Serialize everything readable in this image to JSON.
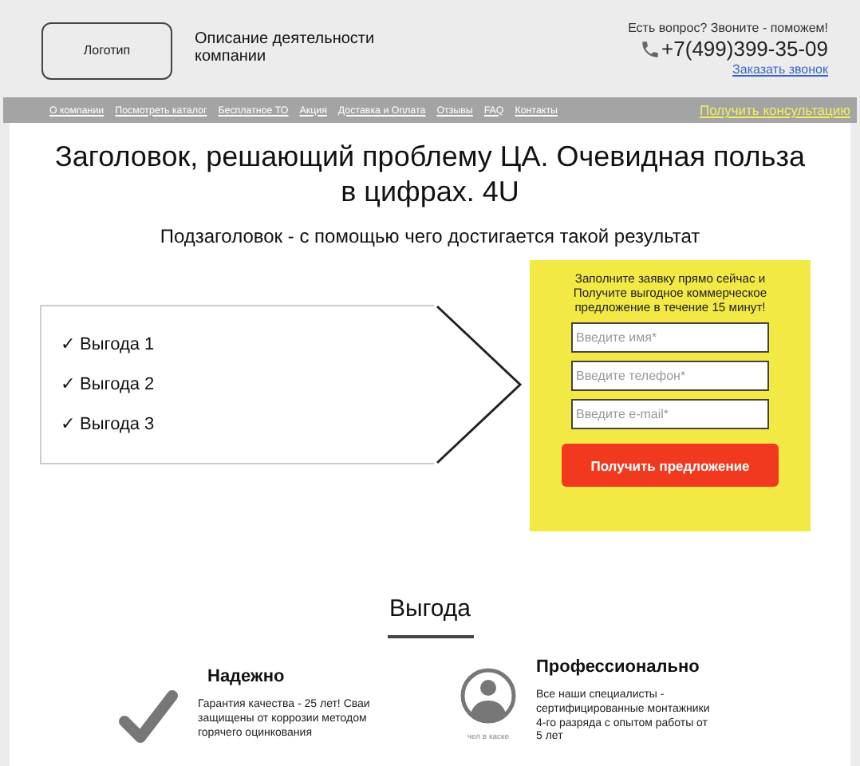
{
  "header": {
    "logo": "Логотип",
    "description": "Описание деятельности компании",
    "question": "Есть вопрос? Звоните - поможем!",
    "phone": "+7(499)399-35-09",
    "callback": "Заказать звонок"
  },
  "nav": {
    "items": [
      "О компании",
      "Посмотреть каталог",
      "Бесплатное ТО",
      "Акция",
      "Доставка и Оплата",
      "Отзывы",
      "FAQ",
      "Контакты"
    ],
    "cta": "Получить консультацию"
  },
  "hero": {
    "title": "Заголовок, решающий проблему ЦА. Очевидная польза в цифрах. 4U",
    "subtitle": "Подзаголовок - с помощью чего достигается такой результат",
    "benefits": [
      {
        "mark": "✓",
        "text": "Выгода 1"
      },
      {
        "mark": "✓",
        "text": "Выгода 2"
      },
      {
        "mark": "✓",
        "text": "Выгода 3"
      }
    ],
    "form": {
      "text": "Заполните заявку прямо сейчас и Получите выгодное коммерческое предложение в течение 15 минут!",
      "fields": [
        {
          "placeholder": "Введите имя*"
        },
        {
          "placeholder": "Введите телефон*"
        },
        {
          "placeholder": "Введите e-mail*"
        }
      ],
      "button": "Получить предложение"
    }
  },
  "benefits_section": {
    "title": "Выгода",
    "features": [
      {
        "kind": "check",
        "title": "Надежно",
        "text": "Гарантия качества - 25 лет! Сваи защищены от коррозии методом горячего оцинкования"
      },
      {
        "kind": "person",
        "title": "Профессионально",
        "caption": "чел в каске",
        "text": "Все наши специалисты - сертифицированные монтажники 4-го разряда с опытом работы от 5 лет"
      }
    ]
  }
}
